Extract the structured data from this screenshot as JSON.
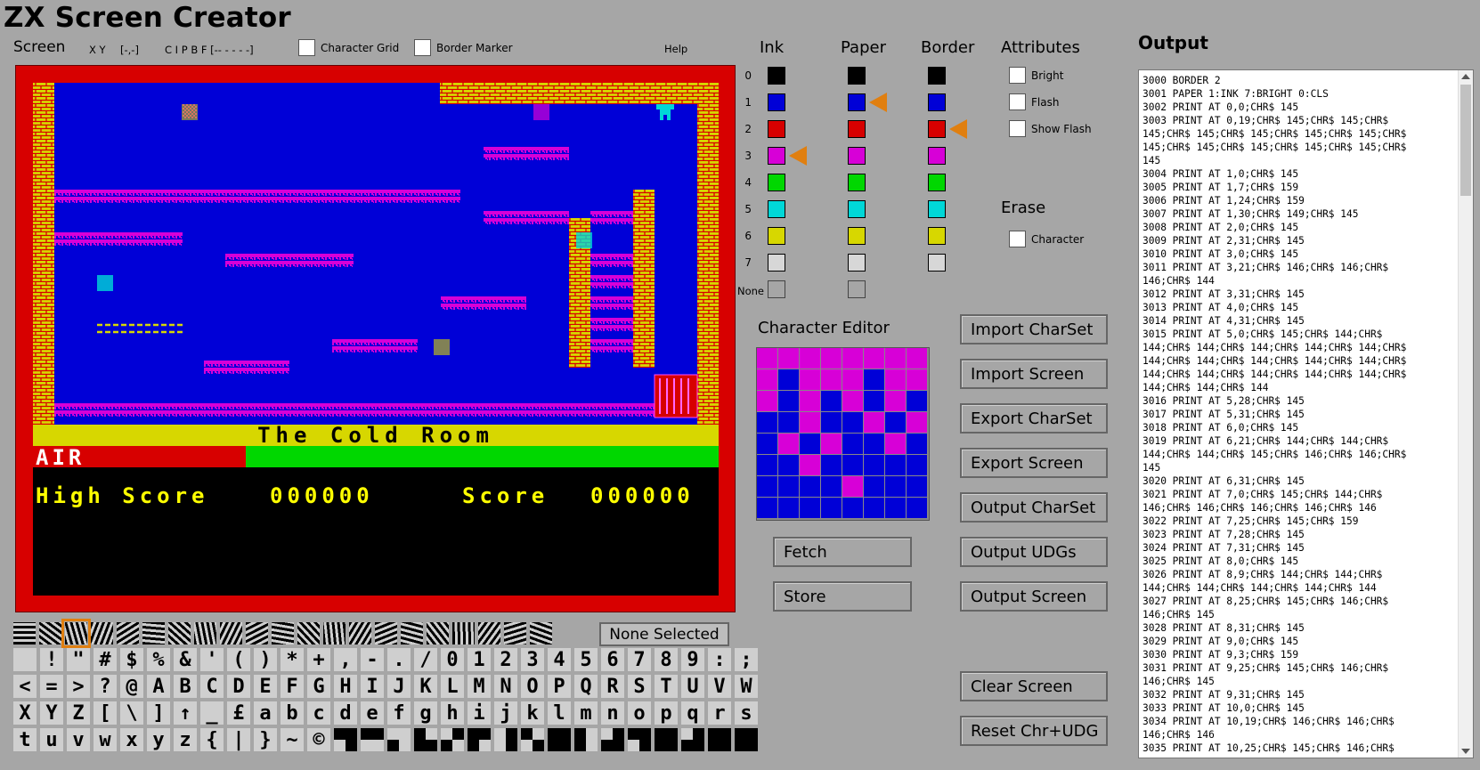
{
  "app": {
    "title": "ZX Screen Creator"
  },
  "toolbar": {
    "screen_label": "Screen",
    "xy": "X Y",
    "coords": "[-,-]",
    "cipbf": "C I P B F [-- - - - -]",
    "char_grid": "Character Grid",
    "border_marker": "Border Marker",
    "help": "Help"
  },
  "zx_screen": {
    "room_name": "The Cold Room",
    "air_label": "AIR",
    "high_score_label": "High Score",
    "high_score": "000000",
    "score_label": "Score",
    "score": "000000",
    "air_fraction": 0.31
  },
  "palette": {
    "ink_header": "Ink",
    "paper_header": "Paper",
    "border_header": "Border",
    "attributes_header": "Attributes",
    "rows": [
      "0",
      "1",
      "2",
      "3",
      "4",
      "5",
      "6",
      "7"
    ],
    "none_label": "None",
    "colors": [
      "#000000",
      "#0000d7",
      "#d70000",
      "#d700d7",
      "#00d700",
      "#00d7d7",
      "#d7d700",
      "#d7d7d7"
    ],
    "selected": {
      "ink": 3,
      "paper": 1,
      "border": 2
    },
    "attributes": {
      "bright": "Bright",
      "flash": "Flash",
      "show_flash": "Show Flash"
    },
    "erase_header": "Erase",
    "erase_character": "Character"
  },
  "editor": {
    "title": "Character Editor",
    "fetch": "Fetch",
    "store": "Store",
    "grid": [
      [
        1,
        1,
        1,
        1,
        1,
        1,
        1,
        1
      ],
      [
        1,
        0,
        1,
        1,
        1,
        0,
        1,
        1
      ],
      [
        1,
        0,
        1,
        0,
        1,
        0,
        1,
        0
      ],
      [
        0,
        0,
        1,
        0,
        0,
        1,
        0,
        1
      ],
      [
        0,
        1,
        0,
        1,
        0,
        0,
        1,
        0
      ],
      [
        0,
        0,
        1,
        0,
        0,
        0,
        0,
        0
      ],
      [
        0,
        0,
        0,
        0,
        1,
        0,
        0,
        0
      ],
      [
        0,
        0,
        0,
        0,
        0,
        0,
        0,
        0
      ]
    ]
  },
  "actions": {
    "import_charset": "Import CharSet",
    "import_screen": "Import Screen",
    "export_charset": "Export CharSet",
    "export_screen": "Export Screen",
    "output_charset": "Output CharSet",
    "output_udgs": "Output UDGs",
    "output_screen": "Output Screen",
    "clear_screen": "Clear Screen",
    "reset": "Reset Chr+UDG"
  },
  "selection": {
    "label": "None Selected"
  },
  "charset_row2": [
    "",
    "!",
    "\"",
    "#",
    "$",
    "%",
    "&",
    "'",
    "(",
    ")",
    "*",
    "+",
    ",",
    "-",
    ".",
    "/",
    "0",
    "1",
    "2",
    "3",
    "4",
    "5",
    "6",
    "7",
    "8",
    "9",
    ":",
    ";"
  ],
  "charset_row3": [
    "<",
    "=",
    ">",
    "?",
    "@",
    "A",
    "B",
    "C",
    "D",
    "E",
    "F",
    "G",
    "H",
    "I",
    "J",
    "K",
    "L",
    "M",
    "N",
    "O",
    "P",
    "Q",
    "R",
    "S",
    "T",
    "U",
    "V",
    "W"
  ],
  "charset_row4": [
    "X",
    "Y",
    "Z",
    "[",
    "\\",
    "]",
    "↑",
    "_",
    "£",
    "a",
    "b",
    "c",
    "d",
    "e",
    "f",
    "g",
    "h",
    "i",
    "j",
    "k",
    "l",
    "m",
    "n",
    "o",
    "p",
    "q",
    "r",
    "s"
  ],
  "charset_row5": [
    "t",
    "u",
    "v",
    "w",
    "x",
    "y",
    "z",
    "{",
    "|",
    "}",
    "~",
    "©"
  ],
  "output": {
    "title": "Output",
    "text": "3000 BORDER 2\n3001 PAPER 1:INK 7:BRIGHT 0:CLS\n3002 PRINT AT 0,0;CHR$ 145\n3003 PRINT AT 0,19;CHR$ 145;CHR$ 145;CHR$\n145;CHR$ 145;CHR$ 145;CHR$ 145;CHR$ 145;CHR$\n145;CHR$ 145;CHR$ 145;CHR$ 145;CHR$ 145;CHR$\n145\n3004 PRINT AT 1,0;CHR$ 145\n3005 PRINT AT 1,7;CHR$ 159\n3006 PRINT AT 1,24;CHR$ 159\n3007 PRINT AT 1,30;CHR$ 149;CHR$ 145\n3008 PRINT AT 2,0;CHR$ 145\n3009 PRINT AT 2,31;CHR$ 145\n3010 PRINT AT 3,0;CHR$ 145\n3011 PRINT AT 3,21;CHR$ 146;CHR$ 146;CHR$\n146;CHR$ 144\n3012 PRINT AT 3,31;CHR$ 145\n3013 PRINT AT 4,0;CHR$ 145\n3014 PRINT AT 4,31;CHR$ 145\n3015 PRINT AT 5,0;CHR$ 145;CHR$ 144;CHR$\n144;CHR$ 144;CHR$ 144;CHR$ 144;CHR$ 144;CHR$\n144;CHR$ 144;CHR$ 144;CHR$ 144;CHR$ 144;CHR$\n144;CHR$ 144;CHR$ 144;CHR$ 144;CHR$ 144;CHR$\n144;CHR$ 144;CHR$ 144\n3016 PRINT AT 5,28;CHR$ 145\n3017 PRINT AT 5,31;CHR$ 145\n3018 PRINT AT 6,0;CHR$ 145\n3019 PRINT AT 6,21;CHR$ 144;CHR$ 144;CHR$\n144;CHR$ 144;CHR$ 145;CHR$ 146;CHR$ 146;CHR$\n145\n3020 PRINT AT 6,31;CHR$ 145\n3021 PRINT AT 7,0;CHR$ 145;CHR$ 144;CHR$\n146;CHR$ 146;CHR$ 146;CHR$ 146;CHR$ 146\n3022 PRINT AT 7,25;CHR$ 145;CHR$ 159\n3023 PRINT AT 7,28;CHR$ 145\n3024 PRINT AT 7,31;CHR$ 145\n3025 PRINT AT 8,0;CHR$ 145\n3026 PRINT AT 8,9;CHR$ 144;CHR$ 144;CHR$\n144;CHR$ 144;CHR$ 144;CHR$ 144;CHR$ 144\n3027 PRINT AT 8,25;CHR$ 145;CHR$ 146;CHR$\n146;CHR$ 145\n3028 PRINT AT 8,31;CHR$ 145\n3029 PRINT AT 9,0;CHR$ 145\n3030 PRINT AT 9,3;CHR$ 159\n3031 PRINT AT 9,25;CHR$ 145;CHR$ 146;CHR$\n146;CHR$ 145\n3032 PRINT AT 9,31;CHR$ 145\n3033 PRINT AT 10,0;CHR$ 145\n3034 PRINT AT 10,19;CHR$ 146;CHR$ 146;CHR$\n146;CHR$ 146\n3035 PRINT AT 10,25;CHR$ 145;CHR$ 146;CHR$"
  }
}
